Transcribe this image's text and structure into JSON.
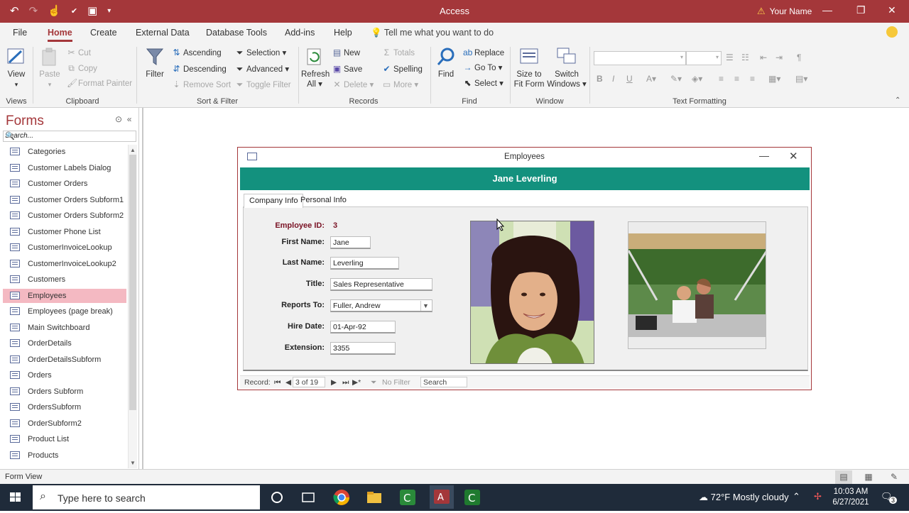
{
  "titlebar": {
    "app_title": "Access",
    "user_name": "Your Name"
  },
  "ribbon_tabs": [
    "File",
    "Home",
    "Create",
    "External Data",
    "Database Tools",
    "Add-ins",
    "Help"
  ],
  "ribbon_active_tab": "Home",
  "tell_me": "Tell me what you want to do",
  "ribbon": {
    "views": {
      "view": "View",
      "label": "Views"
    },
    "clipboard": {
      "paste": "Paste",
      "cut": "Cut",
      "copy": "Copy",
      "format_painter": "Format Painter",
      "label": "Clipboard"
    },
    "sort_filter": {
      "filter": "Filter",
      "ascending": "Ascending",
      "descending": "Descending",
      "remove_sort": "Remove Sort",
      "selection": "Selection",
      "advanced": "Advanced",
      "toggle_filter": "Toggle Filter",
      "label": "Sort & Filter"
    },
    "records": {
      "refresh": "Refresh",
      "refresh_all": "All",
      "new": "New",
      "save": "Save",
      "delete": "Delete",
      "totals": "Totals",
      "spelling": "Spelling",
      "more": "More",
      "label": "Records"
    },
    "find": {
      "find": "Find",
      "replace": "Replace",
      "goto": "Go To",
      "select": "Select",
      "label": "Find"
    },
    "window": {
      "size_to_fit": "Size to",
      "size_to_fit2": "Fit Form",
      "switch": "Switch",
      "switch2": "Windows",
      "label": "Window"
    },
    "text_formatting": {
      "label": "Text Formatting"
    }
  },
  "navpane": {
    "header": "Forms",
    "search_placeholder": "Search...",
    "items": [
      {
        "label": "Categories"
      },
      {
        "label": "Customer Labels Dialog"
      },
      {
        "label": "Customer Orders"
      },
      {
        "label": "Customer Orders Subform1"
      },
      {
        "label": "Customer Orders Subform2"
      },
      {
        "label": "Customer Phone List"
      },
      {
        "label": "CustomerInvoiceLookup"
      },
      {
        "label": "CustomerInvoiceLookup2"
      },
      {
        "label": "Customers"
      },
      {
        "label": "Employees"
      },
      {
        "label": "Employees (page break)"
      },
      {
        "label": "Main Switchboard"
      },
      {
        "label": "OrderDetails"
      },
      {
        "label": "OrderDetailsSubform"
      },
      {
        "label": "Orders"
      },
      {
        "label": "Orders Subform"
      },
      {
        "label": "OrdersSubform"
      },
      {
        "label": "OrderSubform2"
      },
      {
        "label": "Product List"
      },
      {
        "label": "Products"
      }
    ],
    "selected_index": 9
  },
  "form": {
    "window_title": "Employees",
    "header_title": "Jane Leverling",
    "tabs": [
      "Company Info",
      "Personal Info"
    ],
    "active_tab": "Company Info",
    "fields": {
      "employee_id_label": "Employee ID:",
      "employee_id": "3",
      "first_name_label": "First Name:",
      "first_name": "Jane",
      "last_name_label": "Last Name:",
      "last_name": "Leverling",
      "title_label": "Title:",
      "title": "Sales Representative",
      "reports_to_label": "Reports To:",
      "reports_to": "Fuller, Andrew",
      "hire_date_label": "Hire Date:",
      "hire_date": "01-Apr-92",
      "extension_label": "Extension:",
      "extension": "3355"
    },
    "record_nav": {
      "label": "Record:",
      "position": "3 of 19",
      "filter": "No Filter",
      "search": "Search"
    }
  },
  "statusbar": {
    "text": "Form View"
  },
  "taskbar": {
    "search_placeholder": "Type here to search",
    "weather": "72°F  Mostly cloudy",
    "time": "10:03 AM",
    "date": "6/27/2021",
    "notification_count": "3"
  },
  "colors": {
    "access_accent": "#a4373a",
    "form_header": "#13917e",
    "selected_nav": "#f4b9c2"
  }
}
